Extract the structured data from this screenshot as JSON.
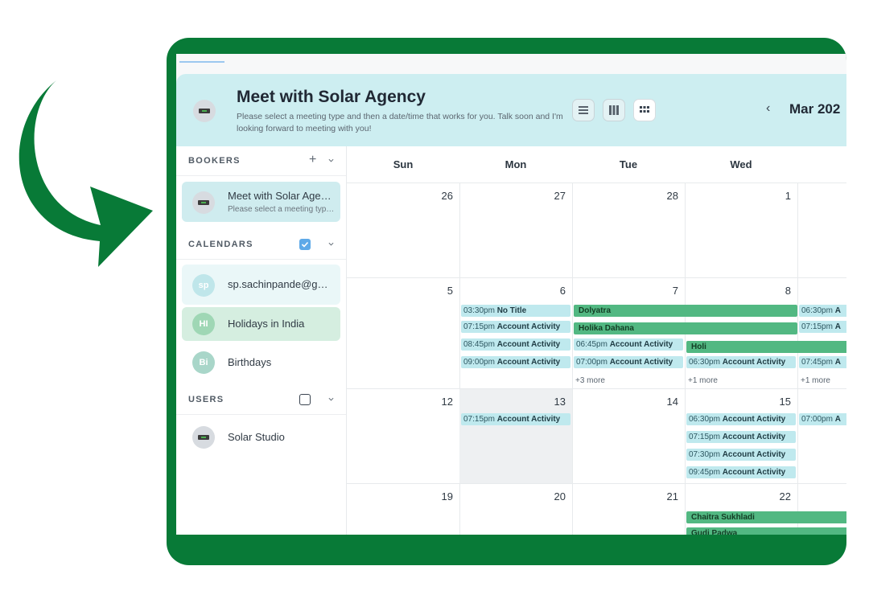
{
  "header": {
    "title": "Meet with Solar Agency",
    "subtitle": "Please select a meeting type and then a date/time that works for you. Talk soon and I'm looking forward to meeting with you!",
    "month": "Mar 202",
    "prev": "‹"
  },
  "sidebar": {
    "bookers": {
      "title": "BOOKERS",
      "add": "+",
      "items": [
        {
          "label": "Meet with Solar Agency",
          "sub": "Please select a meeting type and then a date/time"
        }
      ]
    },
    "calendars": {
      "title": "CALENDARS",
      "items": [
        {
          "initials": "sp",
          "label": "sp.sachinpande@gmail.com",
          "color": "#bfe6ea",
          "bg": "#eaf7f8"
        },
        {
          "initials": "HI",
          "label": "Holidays in India",
          "color": "#9fd7b5",
          "bg": "#d5eee0"
        },
        {
          "initials": "Bi",
          "label": "Birthdays",
          "color": "#a9d6c9",
          "bg": "#ffffff"
        }
      ]
    },
    "users": {
      "title": "USERS",
      "items": [
        {
          "label": "Solar Studio"
        }
      ]
    }
  },
  "calendar": {
    "days": [
      "Sun",
      "Mon",
      "Tue",
      "Wed",
      ""
    ],
    "weeks": [
      [
        "26",
        "27",
        "28",
        "1",
        ""
      ],
      [
        "5",
        "6",
        "7",
        "8",
        ""
      ],
      [
        "12",
        "13",
        "14",
        "15",
        ""
      ],
      [
        "19",
        "20",
        "21",
        "22",
        ""
      ]
    ],
    "events": [
      {
        "time": "03:30pm",
        "title": "No Title"
      },
      {
        "time": "07:15pm",
        "title": "Account Activity"
      },
      {
        "time": "08:45pm",
        "title": "Account Activity"
      },
      {
        "time": "09:00pm",
        "title": "Account Activity"
      },
      {
        "time": "06:45pm",
        "title": "Account Activity"
      },
      {
        "time": "07:00pm",
        "title": "Account Activity"
      },
      {
        "time": "06:30pm",
        "title": "Account Activity"
      },
      {
        "time": "06:30pm",
        "title": "A"
      },
      {
        "time": "07:15pm",
        "title": "A"
      },
      {
        "time": "07:45pm",
        "title": "A"
      },
      {
        "time": "07:15pm",
        "title": "Account Activity"
      },
      {
        "time": "06:30pm",
        "title": "Account Activity"
      },
      {
        "time": "07:15pm",
        "title": "Account Activity"
      },
      {
        "time": "07:30pm",
        "title": "Account Activity"
      },
      {
        "time": "09:45pm",
        "title": "Account Activity"
      },
      {
        "time": "07:00pm",
        "title": "A"
      }
    ],
    "holidays": [
      "Dolyatra",
      "Holika Dahana",
      "Holi",
      "Chaitra Sukhladi",
      "Gudi Padwa"
    ],
    "more": [
      "+3 more",
      "+1 more",
      "+1 more"
    ]
  }
}
